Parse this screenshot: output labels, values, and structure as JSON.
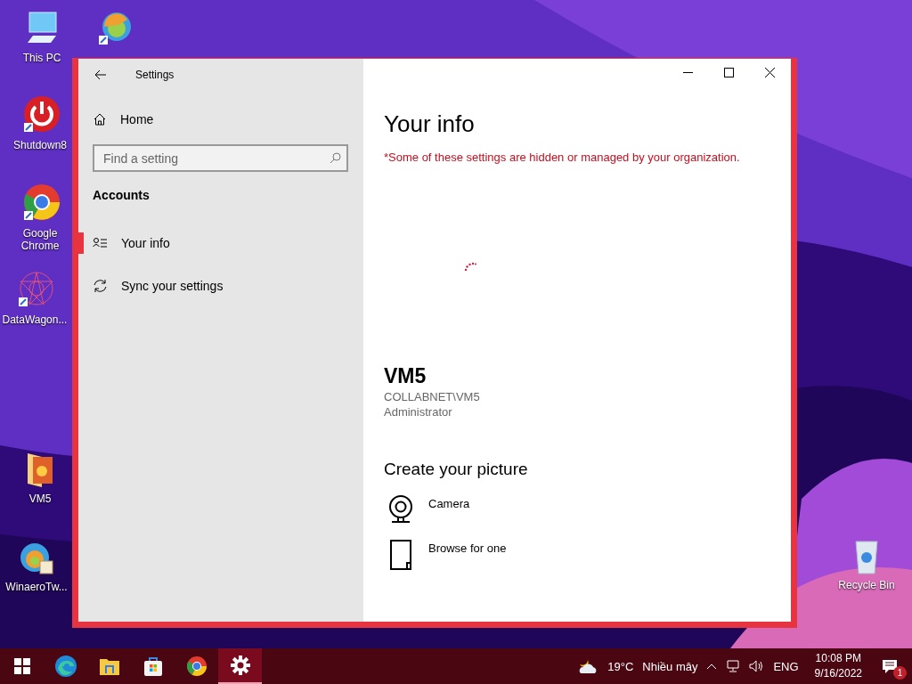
{
  "desktop_icons": [
    {
      "kind": "pc",
      "label": "This PC"
    },
    {
      "kind": "edge-shortcut"
    },
    {
      "kind": "power",
      "label": "Shutdown8"
    },
    {
      "kind": "chrome",
      "label": "Google Chrome"
    },
    {
      "kind": "star",
      "label": "DataWagon..."
    },
    {
      "kind": "folder",
      "label": "VM5"
    },
    {
      "kind": "tweaker",
      "label": "WinaeroTw..."
    },
    {
      "kind": "bin",
      "label": "Recycle Bin"
    }
  ],
  "window": {
    "title": "Settings",
    "sidebar": {
      "home": "Home",
      "search": {
        "placeholder": "Find a setting"
      },
      "section": "Accounts",
      "items": [
        {
          "kind": "person",
          "label": "Your info",
          "selected": true
        },
        {
          "kind": "sync",
          "label": "Sync your settings",
          "selected": false
        }
      ]
    },
    "main": {
      "heading": "Your info",
      "notice": "*Some of these settings are hidden or managed by your organization.",
      "user": {
        "name": "VM5",
        "account": "COLLABNET\\VM5",
        "role": "Administrator"
      },
      "picture_section": {
        "title": "Create your picture",
        "options": [
          {
            "kind": "camera",
            "label": "Camera"
          },
          {
            "kind": "browse",
            "label": "Browse for one"
          }
        ]
      }
    }
  },
  "taskbar": {
    "apps": [
      {
        "kind": "start",
        "selected": false
      },
      {
        "kind": "edge",
        "selected": false
      },
      {
        "kind": "explorer",
        "selected": false
      },
      {
        "kind": "store",
        "selected": false
      },
      {
        "kind": "chrome",
        "selected": false
      },
      {
        "kind": "settings",
        "selected": true
      }
    ],
    "weather": {
      "temperature": "19°C",
      "condition": "Nhiều mây"
    },
    "language": "ENG",
    "time": "10:08 PM",
    "date": "9/16/2022",
    "notification_count": "1"
  }
}
